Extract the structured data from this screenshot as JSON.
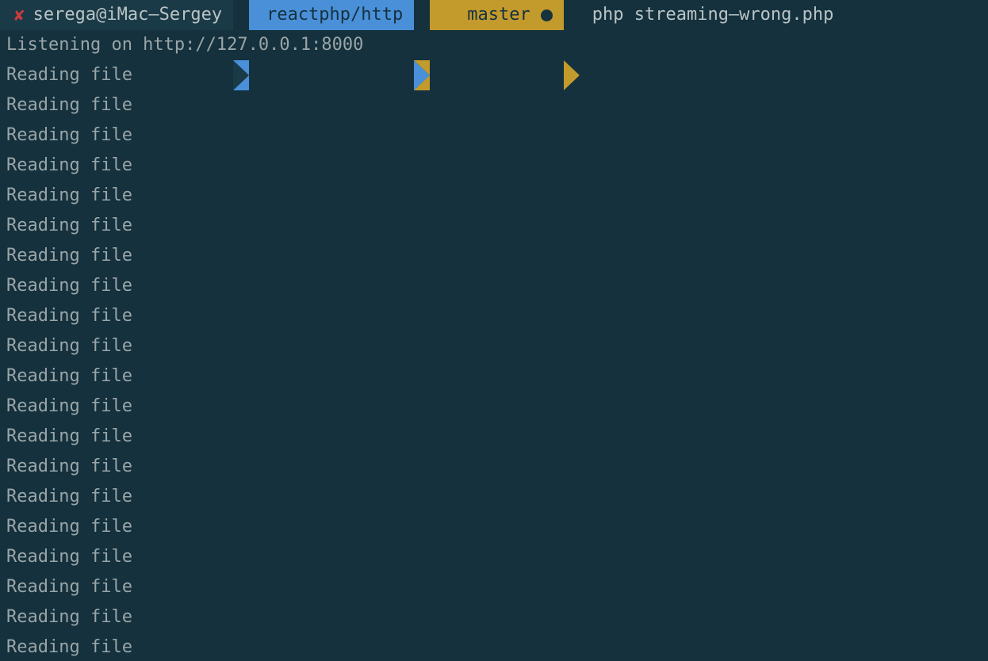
{
  "terminal": {
    "background_color": "#14313d",
    "text_color": "#9aa5a8",
    "prompt": {
      "status_symbol": "✘",
      "status_color": "#cf3b3b",
      "user_host": "serega@iMac—Sergey",
      "user_segment_bg": "#1b3a47",
      "directory": "reactphp/http",
      "directory_segment_bg": "#4a90d9",
      "git_branch": "master",
      "git_segment_bg": "#c39a2c",
      "git_icon": "git-branch-icon",
      "git_dirty_indicator": "dirty-dot",
      "command": "php streaming—wrong.php"
    },
    "output_lines": [
      "Listening on http://127.0.0.1:8000",
      "Reading file",
      "Reading file",
      "Reading file",
      "Reading file",
      "Reading file",
      "Reading file",
      "Reading file",
      "Reading file",
      "Reading file",
      "Reading file",
      "Reading file",
      "Reading file",
      "Reading file",
      "Reading file",
      "Reading file",
      "Reading file",
      "Reading file",
      "Reading file",
      "Reading file",
      "Reading file"
    ]
  }
}
